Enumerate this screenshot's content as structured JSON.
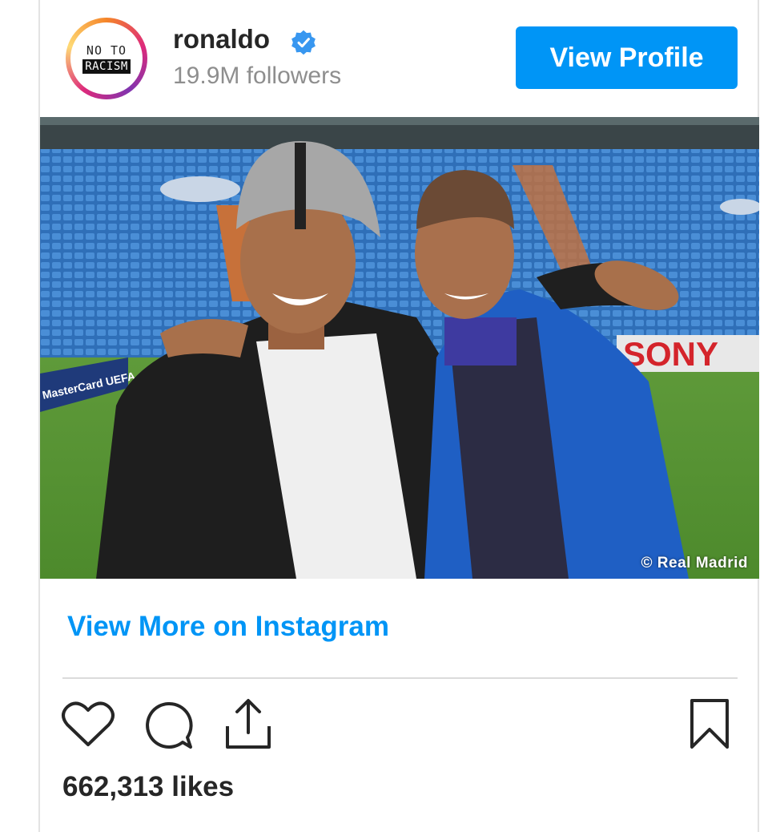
{
  "header": {
    "avatar": {
      "line1": "NO TO",
      "line2": "RACISM"
    },
    "username": "ronaldo",
    "verified_icon": "verified-badge-icon",
    "followers": "19.9M followers",
    "view_profile_label": "View Profile"
  },
  "photo": {
    "stadium_sign": "SONY",
    "ad_board": "MasterCard UEFA",
    "credit": "© Real Madrid"
  },
  "footer": {
    "view_more_label": "View More on Instagram",
    "actions": [
      "heart-icon",
      "comment-icon",
      "share-icon",
      "bookmark-icon"
    ],
    "likes": "662,313 likes"
  },
  "colors": {
    "accent": "#0095f6",
    "text": "#262626",
    "muted": "#8e8e8e"
  }
}
